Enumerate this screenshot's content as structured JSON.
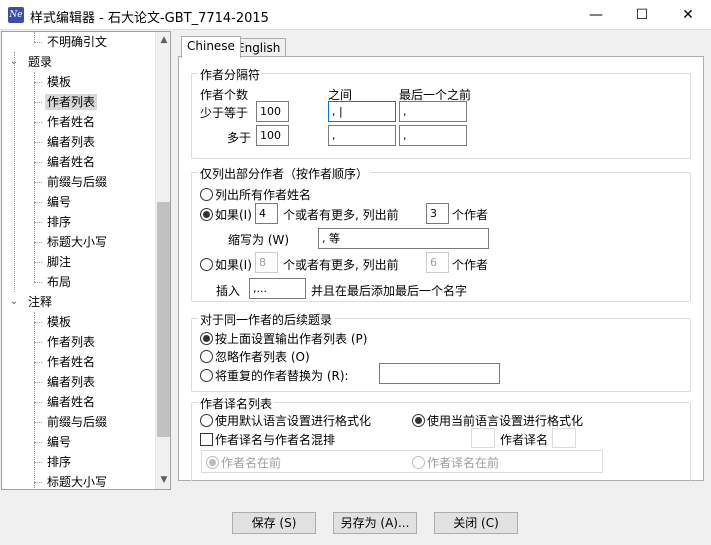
{
  "window": {
    "title": "样式编辑器 - 石大论文-GBT_7714-2015",
    "icon_text": "Ne",
    "minimize": "—",
    "maximize": "☐",
    "close": "✕"
  },
  "tree": {
    "items": [
      {
        "label": "不明确引文",
        "level": 1
      },
      {
        "label": "题录",
        "level": 0,
        "expanded": true
      },
      {
        "label": "模板",
        "level": 1
      },
      {
        "label": "作者列表",
        "level": 1,
        "selected": true
      },
      {
        "label": "作者姓名",
        "level": 1
      },
      {
        "label": "编者列表",
        "level": 1
      },
      {
        "label": "编者姓名",
        "level": 1
      },
      {
        "label": "前缀与后缀",
        "level": 1
      },
      {
        "label": "编号",
        "level": 1
      },
      {
        "label": "排序",
        "level": 1
      },
      {
        "label": "标题大小写",
        "level": 1
      },
      {
        "label": "脚注",
        "level": 1
      },
      {
        "label": "布局",
        "level": 1
      },
      {
        "label": "注释",
        "level": 0,
        "expanded": true
      },
      {
        "label": "模板",
        "level": 1
      },
      {
        "label": "作者列表",
        "level": 1
      },
      {
        "label": "作者姓名",
        "level": 1
      },
      {
        "label": "编者列表",
        "level": 1
      },
      {
        "label": "编者姓名",
        "level": 1
      },
      {
        "label": "前缀与后缀",
        "level": 1
      },
      {
        "label": "编号",
        "level": 1
      },
      {
        "label": "排序",
        "level": 1
      },
      {
        "label": "标题大小写",
        "level": 1
      }
    ],
    "scroll_up": "▲",
    "scroll_down": "▼"
  },
  "tabs": [
    {
      "label": "Chinese",
      "active": true
    },
    {
      "label": "English",
      "active": false
    }
  ],
  "separators": {
    "legend": "作者分隔符",
    "col_count": "作者个数",
    "col_between": "之间",
    "col_last": "最后一个之前",
    "row1_label": "少于等于",
    "row1_count": "100",
    "row1_between": ", |",
    "row1_last": ", ",
    "row2_label": "多于",
    "row2_count": "100",
    "row2_between": ", ",
    "row2_last": ", "
  },
  "partial": {
    "legend": "仅列出部分作者（按作者顺序）",
    "opt_all": "列出所有作者姓名",
    "opt_if1": "如果(I)",
    "if1_count": "4",
    "if1_mid": "个或者有更多, 列出前",
    "if1_first": "3",
    "if1_suffix": "个作者",
    "abbrev_label": "缩写为 (W)",
    "abbrev_value": ", 等",
    "opt_if2": "如果(I)",
    "if2_count": "8",
    "if2_mid": "个或者有更多, 列出前",
    "if2_first": "6",
    "if2_suffix": "个作者",
    "insert_label": "插入",
    "insert_value": ",...",
    "insert_suffix": "并且在最后添加最后一个名字"
  },
  "subsequent": {
    "legend": "对于同一作者的后续题录",
    "opt_above": "按上面设置输出作者列表 (P)",
    "opt_omit": "忽略作者列表 (O)",
    "opt_replace": "将重复的作者替换为 (R):",
    "replace_value": ""
  },
  "translated": {
    "legend": "作者译名列表",
    "opt_default": "使用默认语言设置进行格式化",
    "opt_current": "使用当前语言设置进行格式化",
    "mix_label": "作者译名与作者名混排",
    "trans_label": "作者译名",
    "name_first": "作者名在前",
    "trans_first": "作者译名在前"
  },
  "footer": {
    "save": "保存 (S)",
    "save_as": "另存为 (A)...",
    "close": "关闭 (C)"
  }
}
